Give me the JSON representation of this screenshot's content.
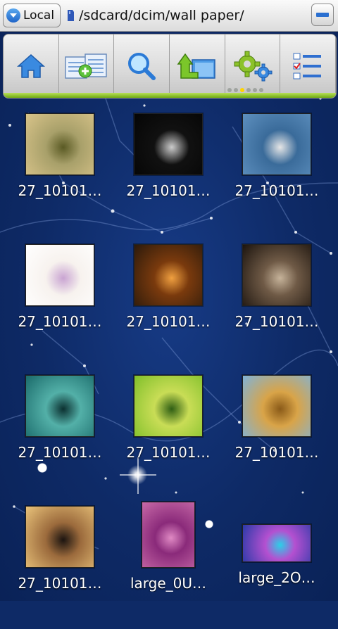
{
  "pathbar": {
    "location_label": "Local",
    "path": "/sdcard/dcim/wall paper/"
  },
  "toolbar": {
    "buttons": [
      {
        "name": "home-icon"
      },
      {
        "name": "multi-add-icon"
      },
      {
        "name": "search-icon"
      },
      {
        "name": "go-up-folder-icon"
      },
      {
        "name": "settings-gears-icon"
      },
      {
        "name": "list-view-icon"
      }
    ],
    "page_dots": 6,
    "active_dot": 3
  },
  "files": [
    {
      "name": "27_10101…",
      "thumb_colors": [
        "#d9c48a",
        "#a8a06a",
        "#5a5a24"
      ]
    },
    {
      "name": "27_10101…",
      "thumb_colors": [
        "#050505",
        "#111111",
        "#cccccc"
      ]
    },
    {
      "name": "27_10101…",
      "thumb_colors": [
        "#5e90bf",
        "#3a6b9a",
        "#e6e6e6"
      ]
    },
    {
      "name": "27_10101…",
      "thumb_colors": [
        "#ffffff",
        "#f7f2ee",
        "#c9a4d2"
      ]
    },
    {
      "name": "27_10101…",
      "thumb_colors": [
        "#2b1a0c",
        "#7a3a0d",
        "#f0a040"
      ]
    },
    {
      "name": "27_10101…",
      "thumb_colors": [
        "#1c140e",
        "#6f5a46",
        "#c6b39a"
      ]
    },
    {
      "name": "27_10101…",
      "thumb_colors": [
        "#1a6a6a",
        "#53b0a8",
        "#0b3030"
      ]
    },
    {
      "name": "27_10101…",
      "thumb_colors": [
        "#7fbf2a",
        "#c9dd56",
        "#2f5e14"
      ]
    },
    {
      "name": "27_10101…",
      "thumb_colors": [
        "#7fb3d9",
        "#d9a448",
        "#8a5a18"
      ]
    },
    {
      "name": "27_10101…",
      "thumb_colors": [
        "#e9c37a",
        "#9b6a3c",
        "#1b1410"
      ]
    },
    {
      "name": "large_0U…",
      "thumb_colors": [
        "#c86aa8",
        "#8a2a7a",
        "#e08ac4"
      ]
    },
    {
      "name": "large_2O…",
      "thumb_colors": [
        "#2a3aa8",
        "#b450d0",
        "#2ad0e8"
      ]
    }
  ]
}
